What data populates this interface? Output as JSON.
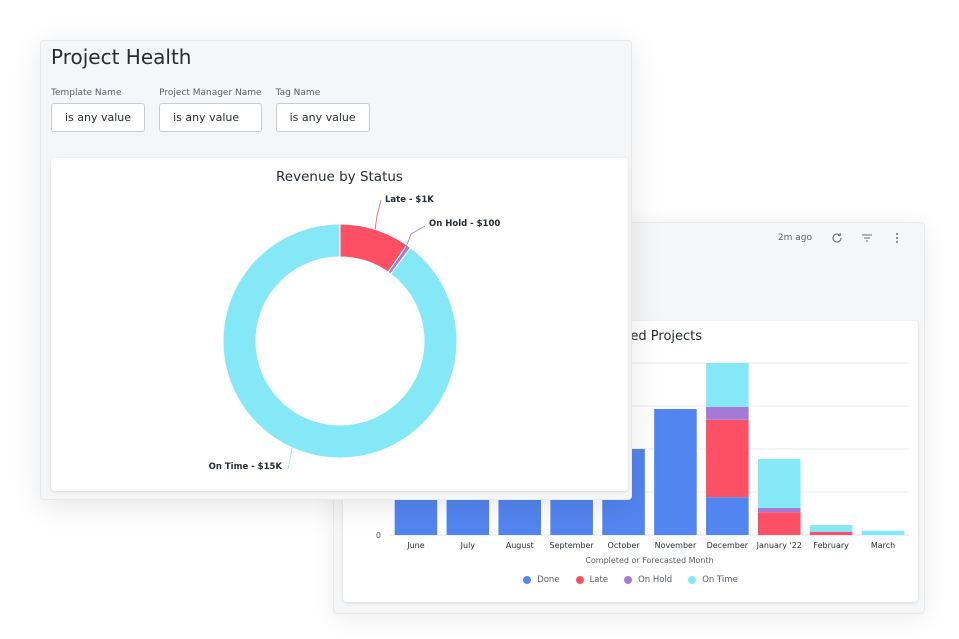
{
  "back_panel": {
    "last_updated": "2m ago",
    "icons": [
      "refresh-icon",
      "filter-icon",
      "more-vertical-icon"
    ],
    "bar_chart_title": "th Forecasted Projects"
  },
  "front_panel": {
    "title": "Project Health",
    "filters": [
      {
        "label": "Template Name",
        "value": "is any value"
      },
      {
        "label": "Project Manager Name",
        "value": "is any value"
      },
      {
        "label": "Tag Name",
        "value": "is any value"
      }
    ]
  },
  "colors": {
    "done": "#5385f0",
    "late": "#fd5064",
    "on_hold": "#a57ad6",
    "on_time": "#85e8f6"
  },
  "chart_data": [
    {
      "type": "pie",
      "title": "Revenue by Status",
      "donut": true,
      "slices": [
        {
          "name": "Late",
          "label": "Late - $1K",
          "value": 1600,
          "color": "#fd5064"
        },
        {
          "name": "On Hold",
          "label": "On Hold - $100",
          "value": 100,
          "color": "#a57ad6"
        },
        {
          "name": "On Time",
          "label": "On Time - $15K",
          "value": 14800,
          "color": "#85e8f6"
        }
      ]
    },
    {
      "type": "bar",
      "stacked": true,
      "title": "th Forecasted Projects",
      "xlabel": "Completed or Forecasted Month",
      "ylabel": "",
      "y_units_note": "values in gridline units (only the 0 tick label is visible)",
      "ylim": [
        0,
        4
      ],
      "yticks_visible": [
        "0"
      ],
      "grid": true,
      "legend_position": "bottom",
      "categories": [
        "June",
        "July",
        "August",
        "September",
        "October",
        "November",
        "December",
        "January '22",
        "February",
        "March"
      ],
      "series": [
        {
          "name": "Done",
          "color": "#5385f0",
          "values": [
            0.88,
            0.88,
            0.88,
            0.88,
            2.0,
            2.93,
            0.88,
            0,
            0,
            0
          ]
        },
        {
          "name": "Late",
          "color": "#fd5064",
          "values": [
            0,
            0,
            0,
            0,
            0,
            0,
            1.8,
            0.53,
            0.07,
            0
          ]
        },
        {
          "name": "On Hold",
          "color": "#a57ad6",
          "values": [
            0,
            0,
            0,
            0,
            0,
            0,
            0.3,
            0.1,
            0,
            0
          ]
        },
        {
          "name": "On Time",
          "color": "#85e8f6",
          "values": [
            0,
            0,
            0,
            0,
            0,
            0,
            1.02,
            1.14,
            0.16,
            0.1
          ]
        }
      ]
    }
  ]
}
